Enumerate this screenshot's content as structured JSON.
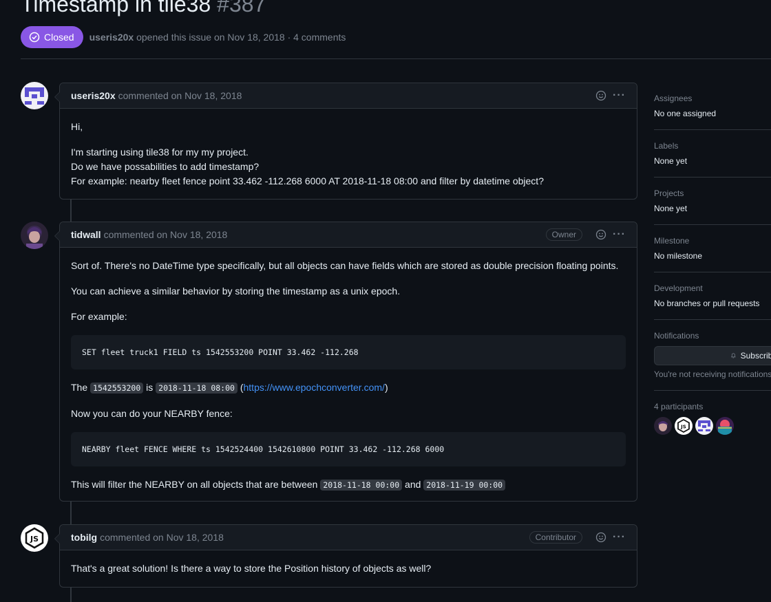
{
  "issue": {
    "title": "Timestamp in tile38",
    "number": "#387",
    "state": "Closed",
    "author": "useris20x",
    "opened_text": "opened this issue on Nov 18, 2018 · 4 comments"
  },
  "comments": [
    {
      "author": "useris20x",
      "meta": "commented on Nov 18, 2018",
      "role": "",
      "paragraphs": [
        "Hi,",
        "I'm starting using tile38 for my my project.",
        "Do we have possabilities to add timestamp?",
        "For example: nearby fleet fence point 33.462 -112.268 6000 AT 2018-11-18 08:00 and filter by datetime object?"
      ]
    },
    {
      "author": "tidwall",
      "meta": "commented on Nov 18, 2018",
      "role": "Owner",
      "p1": "Sort of. There's no DateTime type specifically, but all objects can have fields which are stored as double precision floating points.",
      "p2": "You can achieve a similar behavior by storing the timestamp as a unix epoch.",
      "p3": "For example:",
      "code1": "SET fleet truck1 FIELD ts 1542553200 POINT 33.462 -112.268",
      "p4_a": "The ",
      "p4_code1": "1542553200",
      "p4_b": " is ",
      "p4_code2": "2018-11-18 08:00",
      "p4_c": " (",
      "p4_link": "https://www.epochconverter.com/",
      "p4_d": ")",
      "p5": "Now you can do your NEARBY fence:",
      "code2": "NEARBY fleet FENCE WHERE ts 1542524400 1542610800 POINT 33.462 -112.268 6000",
      "p6_a": "This will filter the NEARBY on all objects that are between ",
      "p6_code1": "2018-11-18 00:00",
      "p6_b": " and ",
      "p6_code2": "2018-11-19 00:00"
    },
    {
      "author": "tobilg",
      "meta": "commented on Nov 18, 2018",
      "role": "Contributor",
      "paragraphs": [
        "That's a great solution! Is there a way to store the Position history of objects as well?"
      ]
    }
  ],
  "sidebar": {
    "assignees_label": "Assignees",
    "assignees_value": "No one assigned",
    "labels_label": "Labels",
    "labels_value": "None yet",
    "projects_label": "Projects",
    "projects_value": "None yet",
    "milestone_label": "Milestone",
    "milestone_value": "No milestone",
    "development_label": "Development",
    "development_value": "No branches or pull requests",
    "notifications_label": "Notifications",
    "subscribe_label": "Subscribe",
    "notifications_note": "You're not receiving notifications",
    "participants_label": "4 participants"
  },
  "colors": {
    "closed_badge": "#8957e5",
    "link": "#4493f8",
    "background": "#0d1117"
  }
}
